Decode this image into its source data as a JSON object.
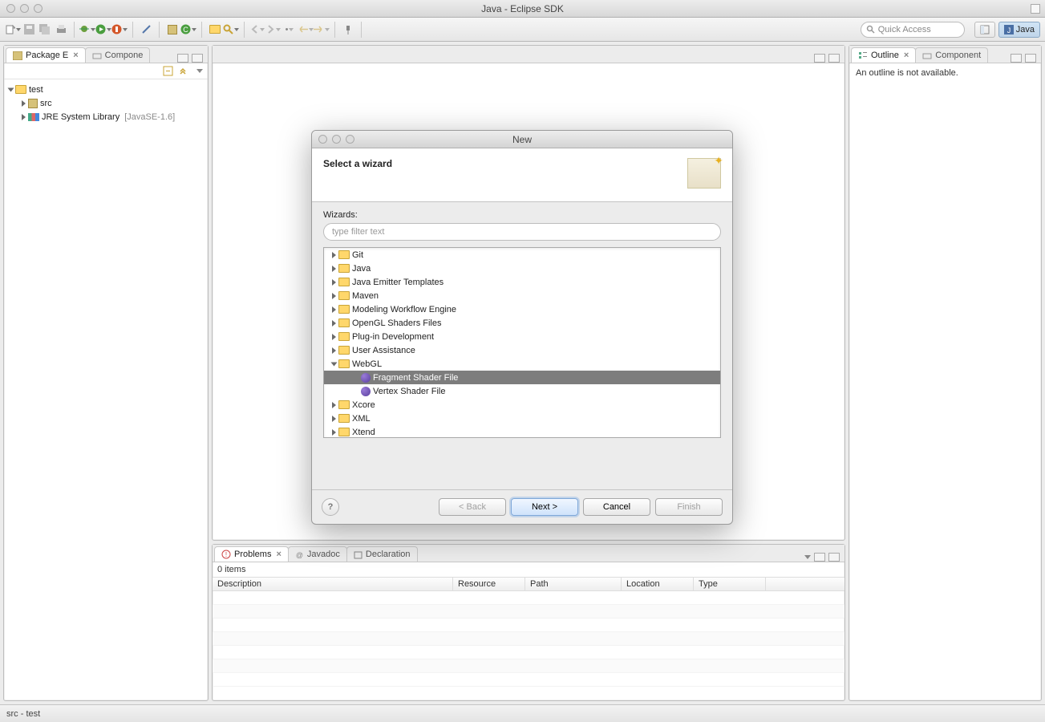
{
  "window": {
    "title": "Java - Eclipse SDK"
  },
  "quick_access": {
    "placeholder": "Quick Access",
    "icon": "search"
  },
  "perspective": {
    "open_label": "",
    "java_label": "Java"
  },
  "left_panel": {
    "tab1": "Package E",
    "tab2": "Compone",
    "tree": {
      "project": "test",
      "src": "src",
      "jre": "JRE System Library",
      "jre_env": "[JavaSE-1.6]"
    }
  },
  "right_panel": {
    "tab1": "Outline",
    "tab2": "Component",
    "body": "An outline is not available."
  },
  "bottom_panel": {
    "tabs": {
      "problems": "Problems",
      "javadoc": "Javadoc",
      "declaration": "Declaration"
    },
    "items_text": "0 items",
    "columns": {
      "description": "Description",
      "resource": "Resource",
      "path": "Path",
      "location": "Location",
      "type": "Type"
    }
  },
  "status": {
    "text": "src - test"
  },
  "dialog": {
    "title": "New",
    "heading": "Select a wizard",
    "wizards_label": "Wizards:",
    "filter_placeholder": "type filter text",
    "items": [
      {
        "label": "Git",
        "t": "folder"
      },
      {
        "label": "Java",
        "t": "folder"
      },
      {
        "label": "Java Emitter Templates",
        "t": "folder"
      },
      {
        "label": "Maven",
        "t": "folder"
      },
      {
        "label": "Modeling Workflow Engine",
        "t": "folder"
      },
      {
        "label": "OpenGL Shaders Files",
        "t": "folder"
      },
      {
        "label": "Plug-in Development",
        "t": "folder"
      },
      {
        "label": "User Assistance",
        "t": "folder"
      },
      {
        "label": "WebGL",
        "t": "folder-open",
        "children": [
          {
            "label": "Fragment Shader File",
            "sel": true
          },
          {
            "label": "Vertex Shader File"
          }
        ]
      },
      {
        "label": "Xcore",
        "t": "folder"
      },
      {
        "label": "XML",
        "t": "folder"
      },
      {
        "label": "Xtend",
        "t": "folder"
      }
    ],
    "buttons": {
      "back": "< Back",
      "next": "Next >",
      "cancel": "Cancel",
      "finish": "Finish"
    }
  }
}
